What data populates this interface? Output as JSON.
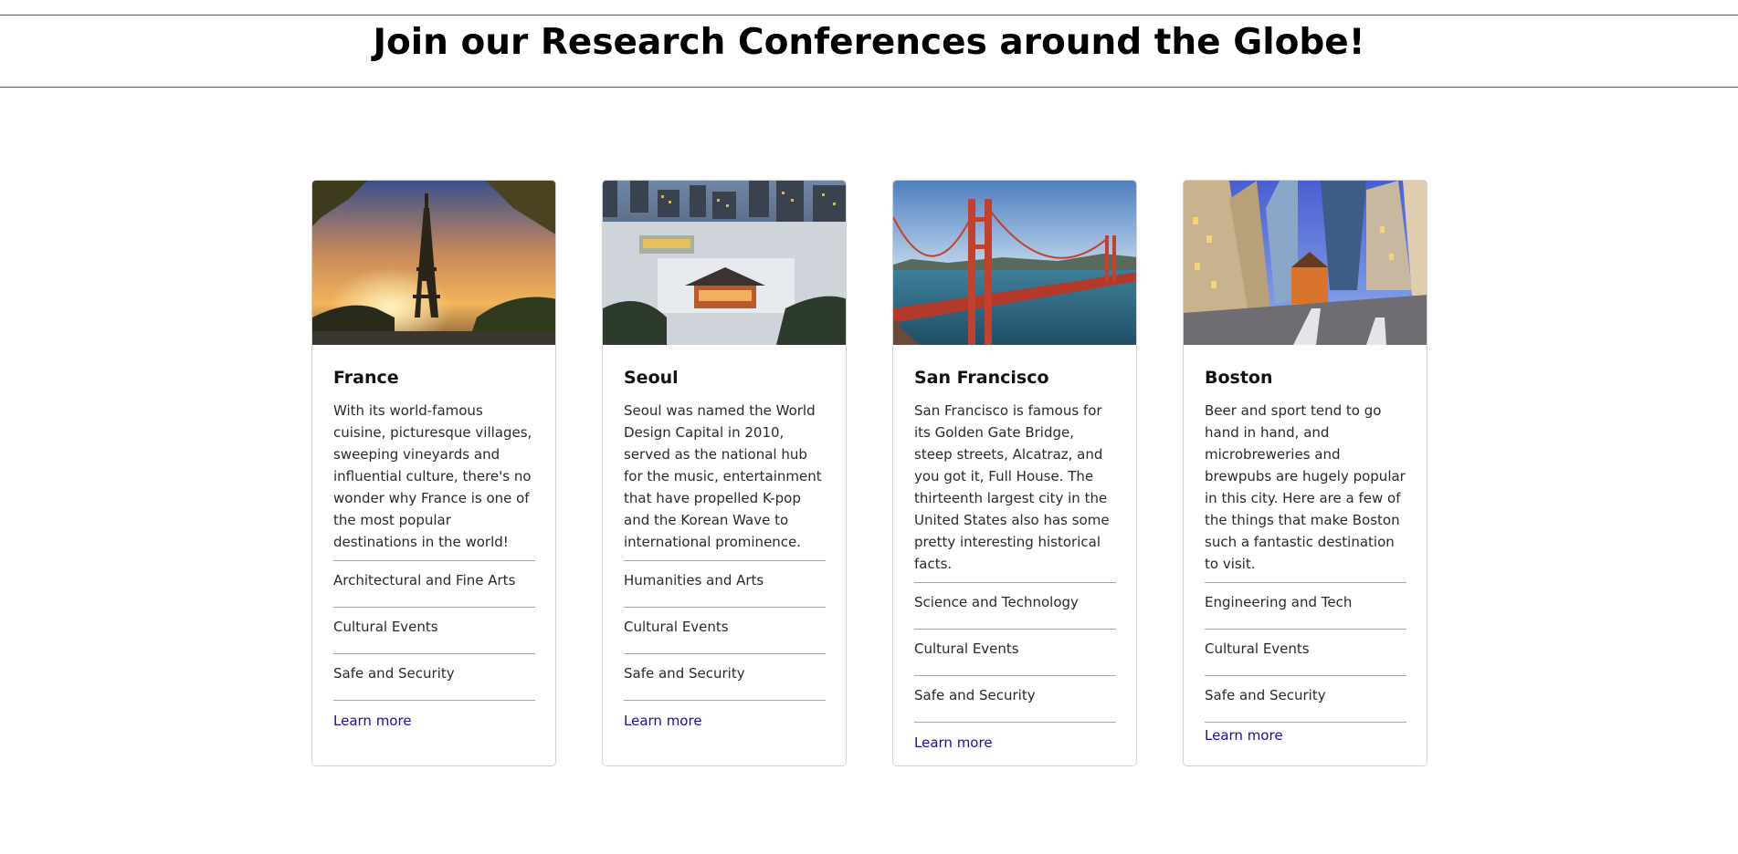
{
  "page": {
    "title": "Join our Research Conferences around the Globe!"
  },
  "cards": [
    {
      "image_icon": "eiffel-tower-photo",
      "title": "France",
      "text": "With its world-famous cuisine, picturesque villages, sweeping vineyards and influential culture, there's no wonder why France is one of the most popular destinations in the world!",
      "topics": [
        "Architectural and Fine Arts",
        "Cultural Events",
        "Safe and Security"
      ],
      "link": "Learn more"
    },
    {
      "image_icon": "seoul-palace-photo",
      "title": "Seoul",
      "text": "Seoul was named the World Design Capital in 2010, served as the national hub for the music, entertainment that have propelled K-pop and the Korean Wave to international prominence.",
      "topics": [
        "Humanities and Arts",
        "Cultural Events",
        "Safe and Security"
      ],
      "link": "Learn more"
    },
    {
      "image_icon": "golden-gate-bridge-photo",
      "title": "San Francisco",
      "text": "San Francisco is famous for its Golden Gate Bridge, steep streets, Alcatraz, and you got it, Full House. The thirteenth largest city in the United States also has some pretty interesting historical facts.",
      "topics": [
        "Science and Technology",
        "Cultural Events",
        "Safe and Security"
      ],
      "link": "Learn more"
    },
    {
      "image_icon": "boston-street-photo",
      "title": "Boston",
      "text": "Beer and sport tend to go hand in hand, and microbreweries and brewpubs are hugely popular in this city. Here are a few of the things that make Boston such a fantastic destination to visit.",
      "topics": [
        "Engineering and Tech",
        "Cultural Events",
        "Safe and Security"
      ],
      "link": "Learn more"
    }
  ],
  "colors": {
    "link": "#1a0dab",
    "border": "#d3d3d3",
    "divider": "#a6a6a6"
  }
}
